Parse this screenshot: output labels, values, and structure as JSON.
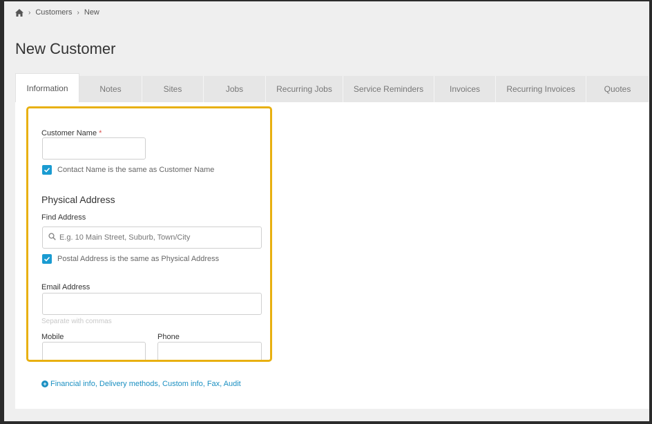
{
  "breadcrumb": {
    "items": [
      "Customers",
      "New"
    ]
  },
  "page": {
    "title": "New Customer"
  },
  "tabs": [
    {
      "label": "Information",
      "active": true
    },
    {
      "label": "Notes"
    },
    {
      "label": "Sites"
    },
    {
      "label": "Jobs"
    },
    {
      "label": "Recurring Jobs"
    },
    {
      "label": "Service Reminders"
    },
    {
      "label": "Invoices"
    },
    {
      "label": "Recurring Invoices"
    },
    {
      "label": "Quotes"
    }
  ],
  "form": {
    "customer_name_label": "Customer Name",
    "required_mark": "*",
    "customer_name_value": "",
    "contact_same_label": "Contact Name is the same as Customer Name",
    "contact_same_checked": true,
    "physical_address_heading": "Physical Address",
    "find_address_label": "Find Address",
    "find_address_placeholder": "E.g. 10 Main Street, Suburb, Town/City",
    "postal_same_label": "Postal Address is the same as Physical Address",
    "postal_same_checked": true,
    "email_label": "Email Address",
    "email_value": "",
    "email_hint": "Separate with commas",
    "mobile_label": "Mobile",
    "phone_label": "Phone"
  },
  "more_link": "Financial info, Delivery methods, Custom info, Fax, Audit",
  "colors": {
    "accent": "#1a9bd1",
    "highlight": "#e8b010",
    "link": "#1a8fc1"
  }
}
